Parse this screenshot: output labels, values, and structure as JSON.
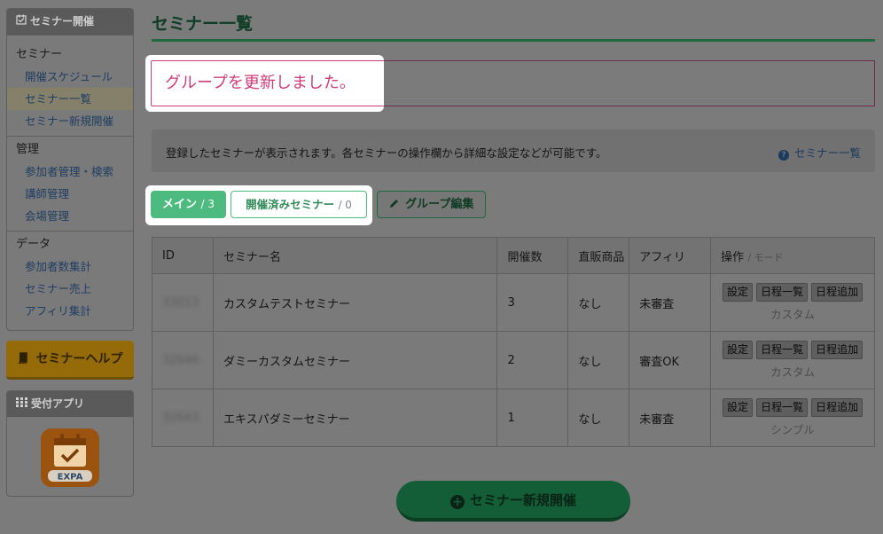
{
  "sidebar": {
    "seminar_header": "セミナー開催",
    "groups": [
      {
        "title": "セミナー",
        "items": [
          "開催スケジュール",
          "セミナー一覧",
          "セミナー新規開催"
        ]
      },
      {
        "title": "管理",
        "items": [
          "参加者管理・検索",
          "講師管理",
          "会場管理"
        ]
      },
      {
        "title": "データ",
        "items": [
          "参加者数集計",
          "セミナー売上",
          "アフィリ集計"
        ]
      }
    ],
    "active_item": "セミナー一覧",
    "help_button": "セミナーヘルプ",
    "app_header": "受付アプリ",
    "app_icon_text": "EXPA"
  },
  "page": {
    "title": "セミナー一覧",
    "alert": "グループを更新しました。",
    "info_text": "登録したセミナーが表示されます。各セミナーの操作欄から詳細な設定などが可能です。",
    "info_link": "セミナー一覧",
    "info_icon": "?"
  },
  "tabs": {
    "main_label": "メイン",
    "main_count": "/ 3",
    "done_label": "開催済みセミナー",
    "done_count": "/ 0",
    "group_edit": "グループ編集"
  },
  "table": {
    "headers": {
      "id": "ID",
      "name": "セミナー名",
      "count": "開催数",
      "product": "直販商品",
      "affiliate": "アフィリ",
      "ops": "操作",
      "ops_mode": "/ モード"
    },
    "rows": [
      {
        "id": "33013",
        "name": "カスタムテストセミナー",
        "count": "3",
        "product": "なし",
        "affiliate": "未審査",
        "mode": "カスタム"
      },
      {
        "id": "32646",
        "name": "ダミーカスタムセミナー",
        "count": "2",
        "product": "なし",
        "affiliate": "審査OK",
        "mode": "カスタム"
      },
      {
        "id": "32643",
        "name": "エキスパダミーセミナー",
        "count": "1",
        "product": "なし",
        "affiliate": "未審査",
        "mode": "シンプル"
      }
    ],
    "op_buttons": [
      "設定",
      "日程一覧",
      "日程追加"
    ]
  },
  "new_button": "セミナー新規開催",
  "colors": {
    "accent": "#4dbb80",
    "alert": "#d03a78",
    "help": "#946b08"
  }
}
